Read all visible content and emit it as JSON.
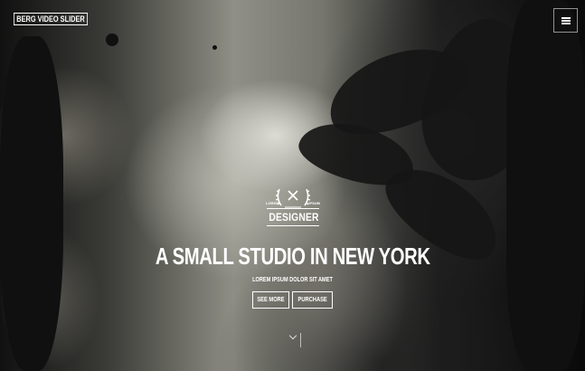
{
  "header": {
    "logo_text": "BERG VIDEO SLIDER",
    "menu_icon": "hamburger-menu-icon"
  },
  "hero": {
    "badge": {
      "title": "DESIGNER",
      "left_text": "LOREM",
      "right_text": "IPSUM",
      "icon": "crossed-tools-laurel-icon"
    },
    "headline": "A SMALL STUDIO IN NEW YORK",
    "subline": "LOREM IPSUM DOLOR SIT AMET",
    "buttons": {
      "see_more": "SEE MORE",
      "purchase": "PURCHASE"
    },
    "scroll_icon": "chevron-down-icon"
  },
  "colors": {
    "text": "#ffffff",
    "background": "#0b0b0b"
  }
}
